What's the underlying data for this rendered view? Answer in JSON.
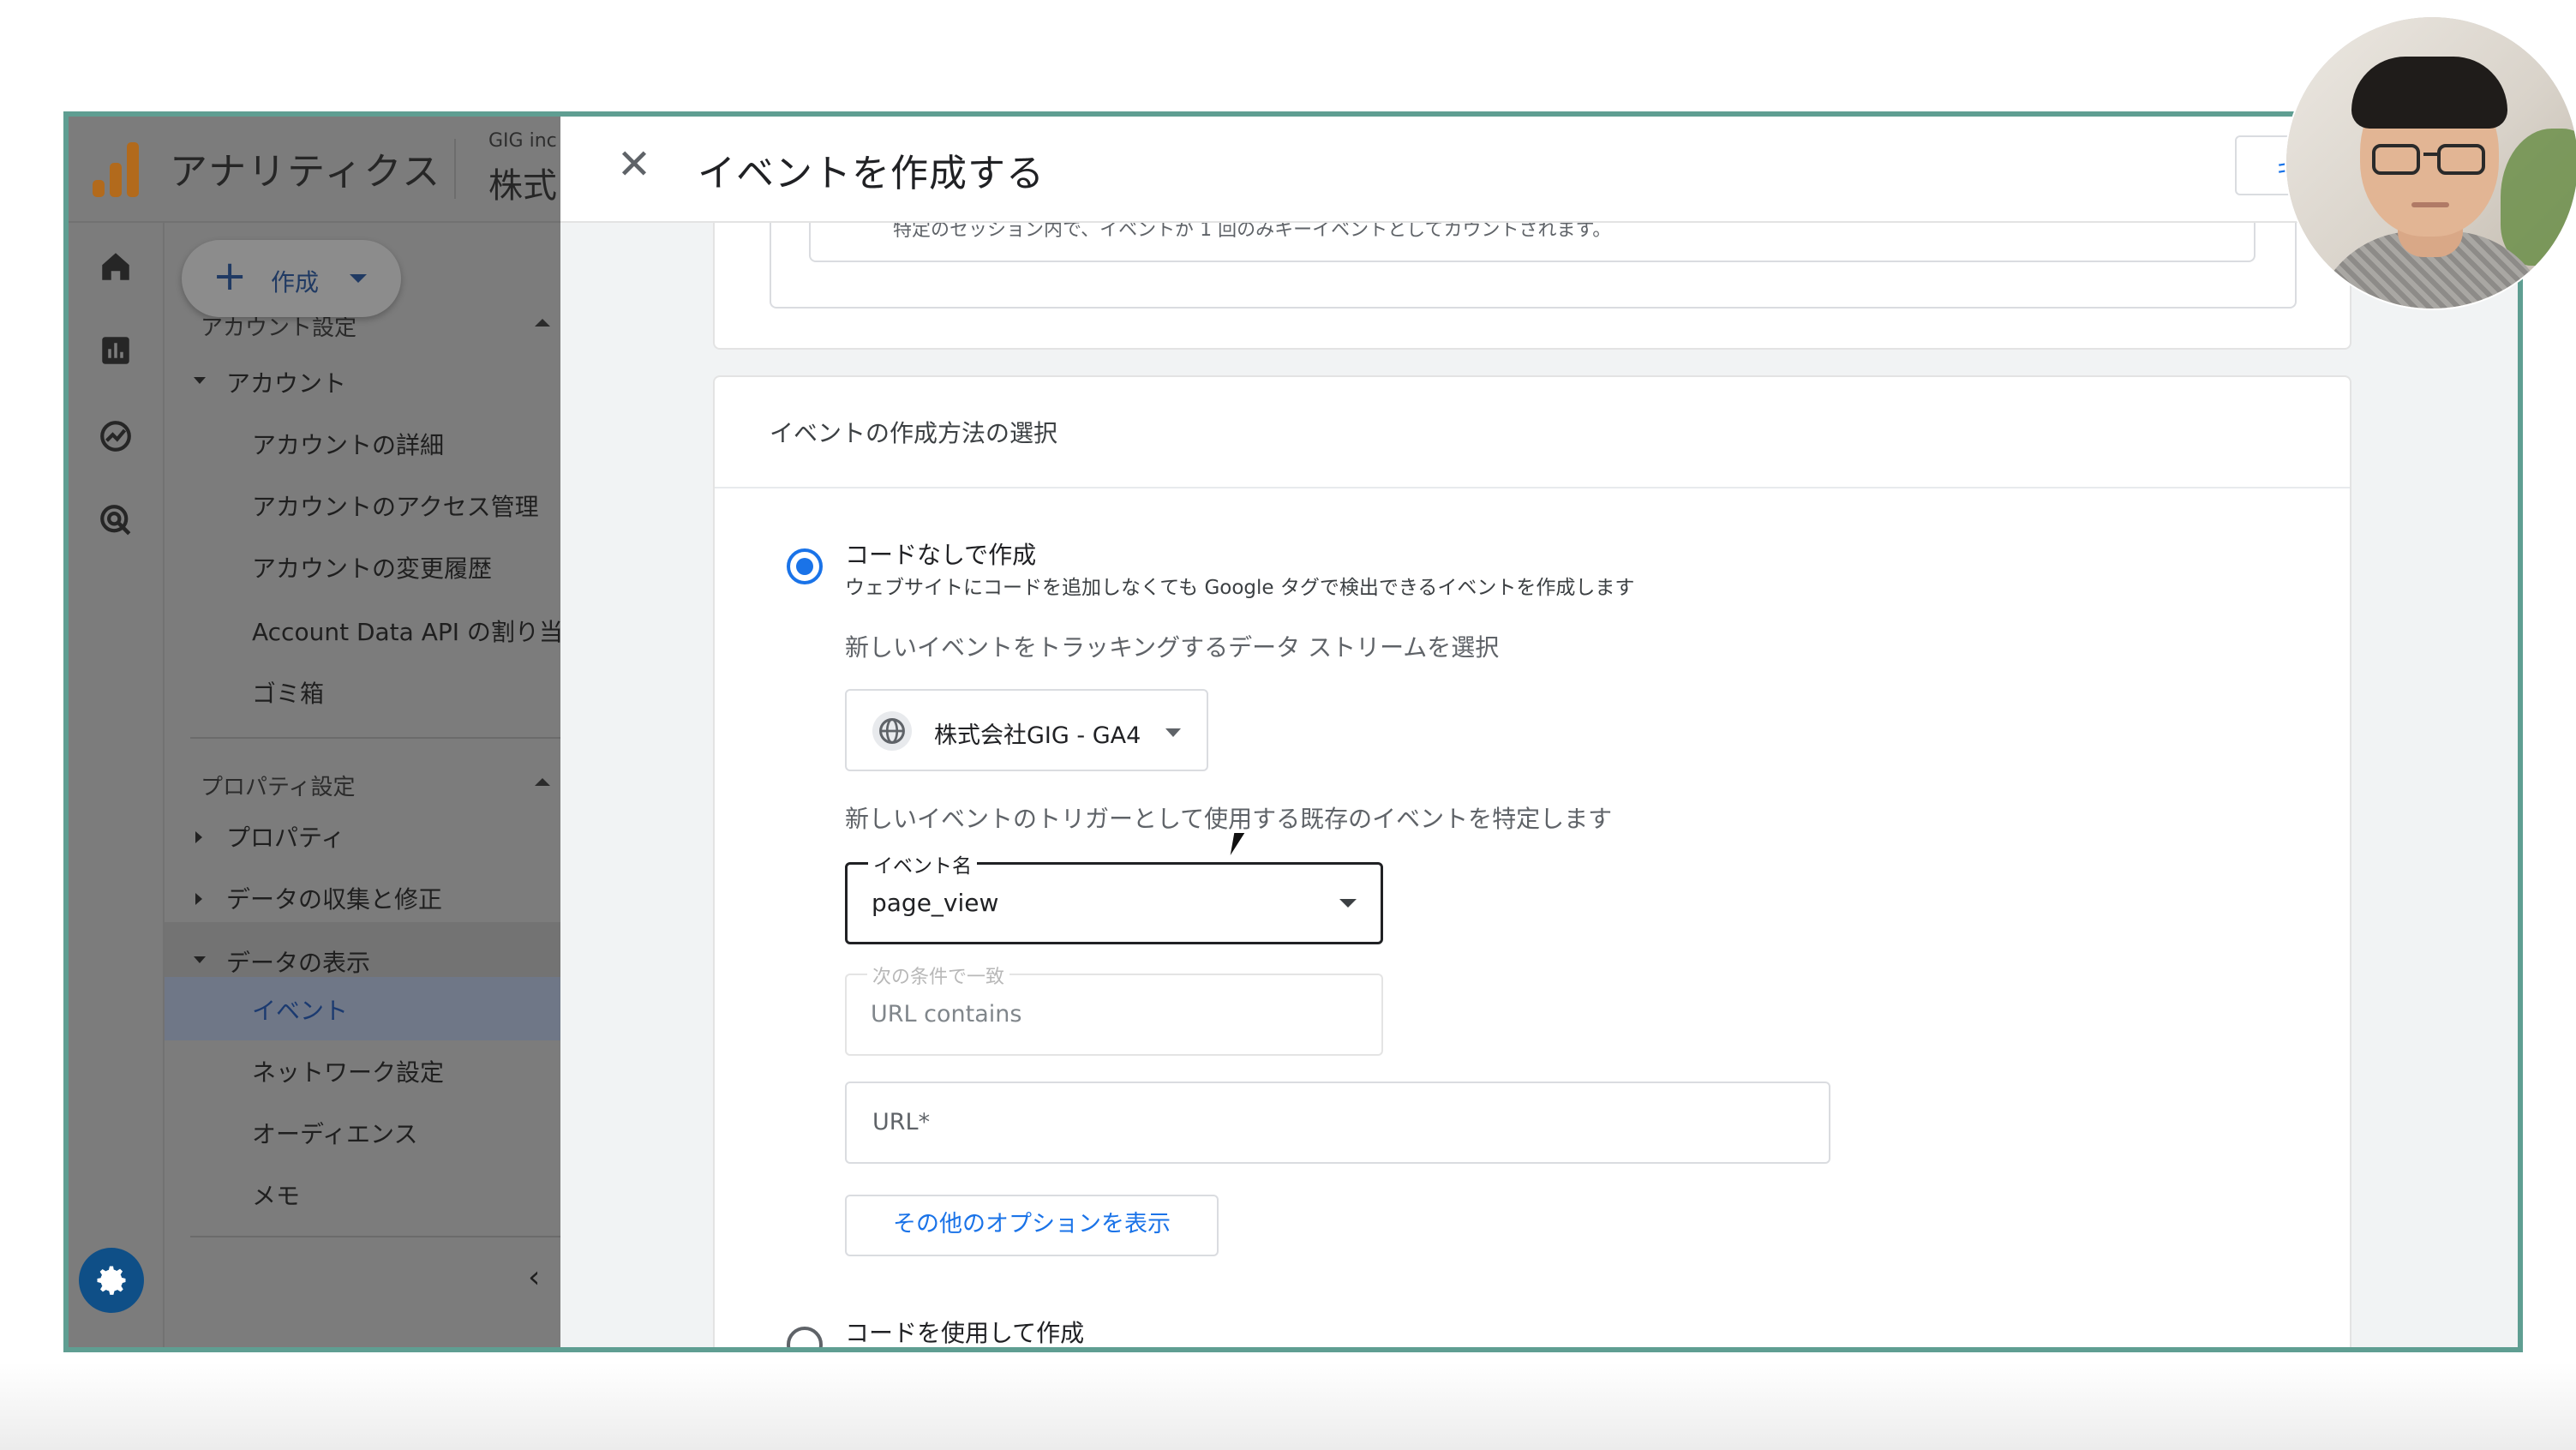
{
  "app": {
    "title": "アナリティクス",
    "org_small": "GIG inc",
    "org_big": "株式"
  },
  "create_button": {
    "label": "作成"
  },
  "sidebar": {
    "account_section": "アカウント設定",
    "account_group": "アカウント",
    "account_items": [
      "アカウントの詳細",
      "アカウントのアクセス管理",
      "アカウントの変更履歴",
      "Account Data API の割り当",
      "ゴミ箱"
    ],
    "property_section": "プロパティ設定",
    "property_groups": [
      "プロパティ",
      "データの収集と修正",
      "データの表示"
    ],
    "display_items": [
      "イベント",
      "ネットワーク設定",
      "オーディエンス",
      "メモ"
    ]
  },
  "dialog": {
    "title": "イベントを作成する",
    "cancel_label": "キャンセル",
    "top_card_text": "特定のセッション内で、イベントが 1 回のみキーイベントとしてカウントされます。",
    "section_title": "イベントの作成方法の選択",
    "option_nocode": {
      "title": "コードなしで作成",
      "desc": "ウェブサイトにコードを追加しなくても Google タグで検出できるイベントを作成します"
    },
    "stream_label": "新しいイベントをトラッキングするデータ ストリームを選択",
    "stream_value": "株式会社GIG - GA4",
    "trigger_label": "新しいイベントのトリガーとして使用する既存のイベントを特定します",
    "event_field": {
      "label": "イベント名",
      "value": "page_view"
    },
    "condition_field": {
      "label": "次の条件で一致",
      "value": "URL contains"
    },
    "url_field": {
      "placeholder": "URL*"
    },
    "more_options_label": "その他のオプションを表示",
    "option_code": {
      "title": "コードを使用して作成"
    }
  },
  "colors": {
    "accent": "#1a73e8",
    "frame": "#5f9e92",
    "overlay": "#7c7c7c",
    "gear_bg": "#0f4f87"
  }
}
